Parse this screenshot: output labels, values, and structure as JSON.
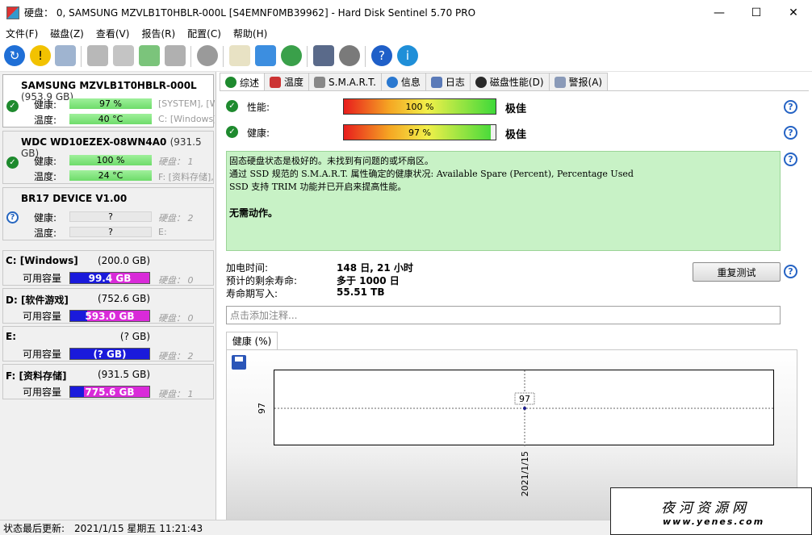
{
  "window": {
    "title": "硬盘： 0, SAMSUNG MZVLB1T0HBLR-000L [S4EMNF0MB39962]  -  Hard Disk Sentinel 5.70 PRO"
  },
  "menu": [
    "文件(F)",
    "磁盘(Z)",
    "查看(V)",
    "报告(R)",
    "配置(C)",
    "帮助(H)"
  ],
  "disks": [
    {
      "name": "SAMSUNG MZVLB1T0HBLR-000L",
      "size": "(953.9 GB)",
      "health_label": "健康:",
      "health": "97 %",
      "health_fraction": 0.97,
      "temp_label": "温度:",
      "temp": "40 °C",
      "health_extra": "[SYSTEM], [W",
      "temp_extra": "C: [Windows],"
    },
    {
      "name": "WDC WD10EZEX-08WN4A0",
      "size": "(931.5 GB)",
      "health_label": "健康:",
      "health": "100 %",
      "health_fraction": 1.0,
      "temp_label": "温度:",
      "temp": "24 °C",
      "health_extra": "硬盘： 1",
      "temp_extra": "F: [资料存储],"
    },
    {
      "name": "BR17    DEVICE V1.00",
      "size": "",
      "health_label": "健康:",
      "health": "?",
      "temp_label": "温度:",
      "temp": "?",
      "health_extra": "硬盘： 2",
      "temp_extra": "E:"
    }
  ],
  "volumes": [
    {
      "name": "C: [Windows]",
      "size": "(200.0 GB)",
      "free_label": "可用容量",
      "free": "99.4 GB",
      "used_fraction": 0.5,
      "disk": "硬盘： 0"
    },
    {
      "name": "D: [软件游戏]",
      "size": "(752.6 GB)",
      "free_label": "可用容量",
      "free": "593.0 GB",
      "used_fraction": 0.21,
      "disk": "硬盘： 0"
    },
    {
      "name": "E:",
      "size": "(? GB)",
      "free_label": "可用容量",
      "free": "(? GB)",
      "used_fraction": 1.0,
      "disk": "硬盘： 2"
    },
    {
      "name": "F: [资料存储]",
      "size": "(931.5 GB)",
      "free_label": "可用容量",
      "free": "775.6 GB",
      "used_fraction": 0.17,
      "disk": "硬盘： 1"
    }
  ],
  "tabs": [
    "综述",
    "温度",
    "S.M.A.R.T.",
    "信息",
    "日志",
    "磁盘性能(D)",
    "警报(A)"
  ],
  "overview": {
    "performance_label": "性能:",
    "performance_value": "100 %",
    "performance_fraction": 1.0,
    "performance_rating": "极佳",
    "health_label": "健康:",
    "health_value": "97 %",
    "health_fraction": 0.97,
    "health_rating": "极佳",
    "status_line1": "固态硬盘状态是极好的。未找到有问题的或坏扇区。",
    "status_line2": "通过 SSD 规范的 S.M.A.R.T. 属性确定的健康状况:  Available Spare (Percent), Percentage Used",
    "status_line3": "SSD 支持 TRIM 功能并已开启来提高性能。",
    "status_action": "无需动作。",
    "power_on_label": "加电时间:",
    "power_on_value": "148 日, 21 小时",
    "remaining_label": "预计的剩余寿命:",
    "remaining_value": "多于 1000 日",
    "written_label": "寿命期写入:",
    "written_value": "55.51 TB",
    "retest_button": "重复测试",
    "note_placeholder": "点击添加注释..."
  },
  "chart": {
    "tab": "健康 (%)"
  },
  "chart_data": {
    "type": "line",
    "x": [
      "2021/1/15"
    ],
    "values": [
      97
    ],
    "yticks": [
      "97"
    ],
    "point_label": "97"
  },
  "statusbar": {
    "label": "状态最后更新:",
    "value": "2021/1/15 星期五 11:21:43"
  },
  "watermark": {
    "title": "夜河资源网",
    "url": "www.yenes.com"
  },
  "colors": {
    "ok_green": "#1e8a2e",
    "status_bg": "#c8f2c6",
    "used_blue": "#1a1adb",
    "free_magenta": "#d92ad9"
  }
}
